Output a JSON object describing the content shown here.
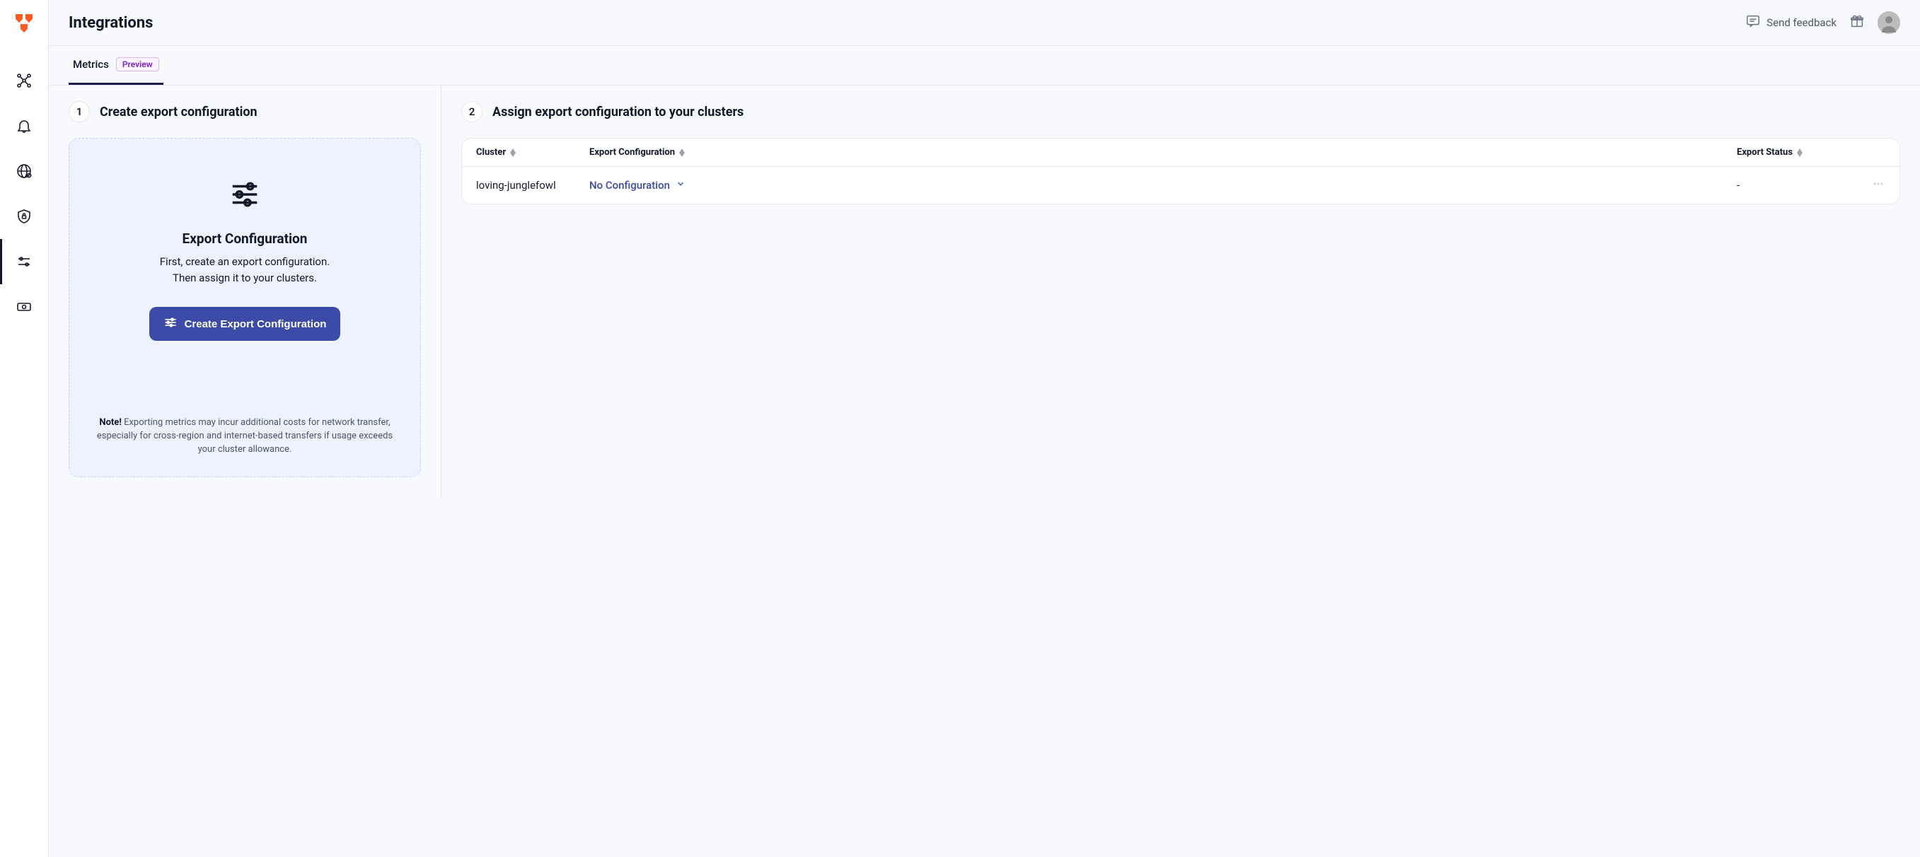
{
  "header": {
    "title": "Integrations",
    "feedback_label": "Send feedback"
  },
  "tabs": {
    "metrics_label": "Metrics",
    "preview_badge": "Preview"
  },
  "step1": {
    "num": "1",
    "title": "Create export configuration",
    "card_title": "Export Configuration",
    "card_desc_line1": "First, create an export configuration.",
    "card_desc_line2": "Then assign it to your clusters.",
    "button_label": "Create Export Configuration",
    "note_strong": "Note!",
    "note_text": " Exporting metrics may incur additional costs for network transfer, especially for cross-region and internet-based transfers if usage exceeds your cluster allowance."
  },
  "step2": {
    "num": "2",
    "title": "Assign export configuration to your clusters",
    "columns": {
      "cluster": "Cluster",
      "config": "Export Configuration",
      "status": "Export Status"
    },
    "rows": [
      {
        "cluster": "loving-junglefowl",
        "config": "No Configuration",
        "status": "-"
      }
    ]
  }
}
